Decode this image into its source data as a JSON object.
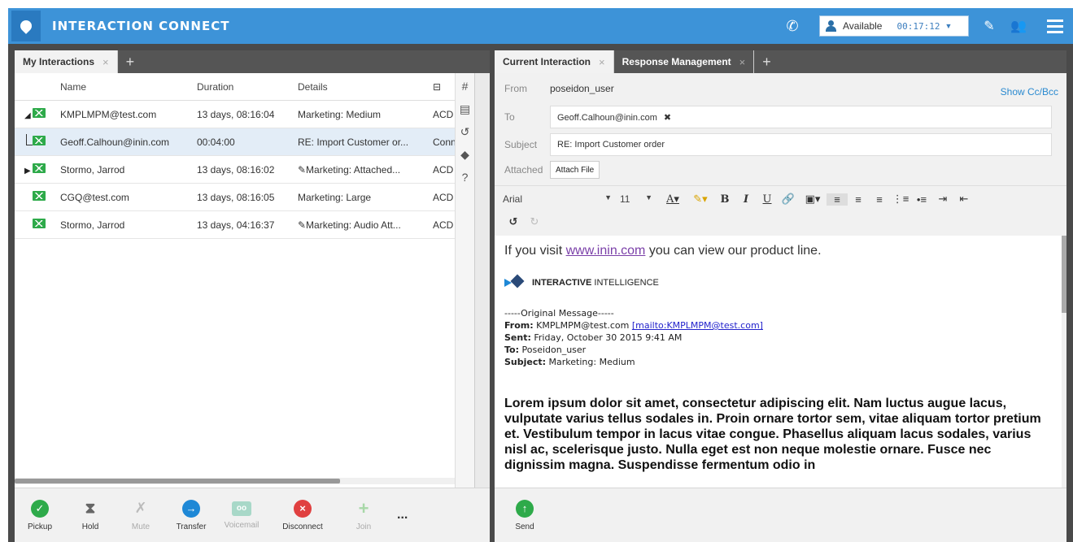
{
  "app": {
    "title": "INTERACTION CONNECT",
    "status": "Available",
    "timer": "00:17:12"
  },
  "left": {
    "tabs": [
      {
        "label": "My Interactions"
      }
    ],
    "columns": {
      "name": "Name",
      "duration": "Duration",
      "details": "Details"
    },
    "rows": [
      {
        "name": "KMPLMPM@test.com",
        "duration": "13 days, 08:16:04",
        "details": "Marketing: Medium",
        "queue": "ACD",
        "tree": "expanded"
      },
      {
        "name": "Geoff.Calhoun@inin.com",
        "duration": "00:04:00",
        "details": "RE: Import Customer or...",
        "queue": "Conn",
        "tree": "child"
      },
      {
        "name": "Stormo, Jarrod",
        "duration": "13 days, 08:16:02",
        "details": "✎Marketing: Attached...",
        "queue": "ACD",
        "tree": "collapsed"
      },
      {
        "name": "CGQ@test.com",
        "duration": "13 days, 08:16:05",
        "details": "Marketing: Large",
        "queue": "ACD",
        "tree": "none"
      },
      {
        "name": "Stormo, Jarrod",
        "duration": "13 days, 04:16:37",
        "details": "✎Marketing: Audio Att...",
        "queue": "ACD",
        "tree": "none"
      }
    ],
    "actions": {
      "pickup": "Pickup",
      "hold": "Hold",
      "mute": "Mute",
      "transfer": "Transfer",
      "voicemail": "Voicemail",
      "disconnect": "Disconnect",
      "join": "Join",
      "more": "..."
    }
  },
  "right": {
    "tabs": [
      {
        "label": "Current Interaction"
      },
      {
        "label": "Response Management"
      }
    ],
    "from_label": "From",
    "from_value": "poseidon_user",
    "show_cc": "Show Cc/Bcc",
    "to_label": "To",
    "to_chip": "Geoff.Calhoun@inin.com",
    "subject_label": "Subject",
    "subject_value": "RE: Import Customer order",
    "attached_label": "Attached",
    "attach_button": "Attach File",
    "font": "Arial",
    "font_size": "11",
    "body": {
      "intro_before": "If you visit ",
      "intro_link": "www.inin.com",
      "intro_after": " you can view our product line.",
      "logo_bold": "INTERACTIVE",
      "logo_rest": " INTELLIGENCE",
      "original_header": "-----Original Message-----",
      "from_label": "From:",
      "from_value": "KMPLMPM@test.com",
      "from_mailto": "[mailto:KMPLMPM@test.com]",
      "sent_label": "Sent:",
      "sent_value": "Friday, October 30 2015 9:41 AM",
      "to_label": "To:",
      "to_value": "Poseidon_user",
      "subject_label": "Subject:",
      "subject_value": "Marketing: Medium",
      "lorem": "Lorem ipsum dolor sit amet, consectetur adipiscing elit. Nam luctus augue lacus, vulputate varius tellus sodales in. Proin ornare tortor sem, vitae aliquam tortor pretium et. Vestibulum tempor in lacus vitae congue. Phasellus aliquam lacus sodales, varius nisl ac, scelerisque justo. Nulla eget est non neque molestie ornare. Fusce nec dignissim magna. Suspendisse fermentum odio in"
    },
    "send": "Send"
  }
}
